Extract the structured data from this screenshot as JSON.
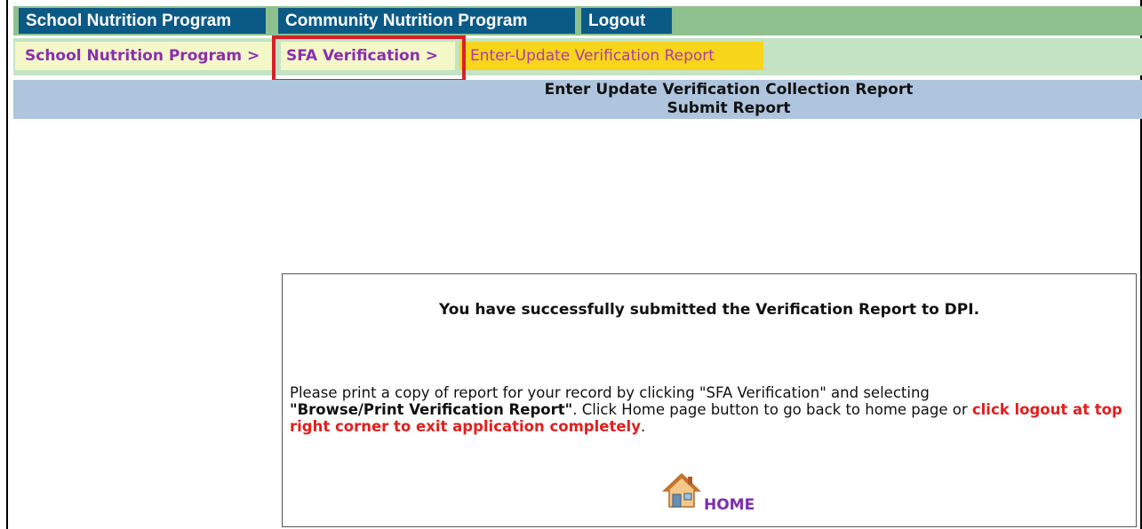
{
  "topnav": {
    "items": [
      {
        "label": "School Nutrition Program"
      },
      {
        "label": "Community Nutrition Program"
      },
      {
        "label": "Logout"
      }
    ]
  },
  "breadcrumb": {
    "items": [
      {
        "label": "School Nutrition Program >"
      },
      {
        "label": "SFA Verification >"
      }
    ],
    "current": "Enter-Update Verification Report"
  },
  "header": {
    "line1": "Enter Update Verification Collection Report",
    "line2": "Submit Report"
  },
  "message": {
    "title": "You have successfully submitted the Verification Report to DPI.",
    "body_part1": "Please print a copy of report for your record by clicking \"SFA Verification\" and selecting",
    "body_bold": "\"Browse/Print Verification Report\"",
    "body_part2": ". Click Home page button to go back to home page or ",
    "body_red": "click logout at top right corner to exit application completely",
    "body_end": "."
  },
  "home": {
    "label": "HOME",
    "icon": "house-icon"
  },
  "colors": {
    "nav_tab": "#0b5a86",
    "nav_bar": "#8fc18f",
    "crumb_bar": "#c4e3c4",
    "crumb_current": "#f7d51a",
    "header_band": "#aec5dd",
    "highlight": "#d6202a",
    "link_purple": "#8a2fb0"
  }
}
